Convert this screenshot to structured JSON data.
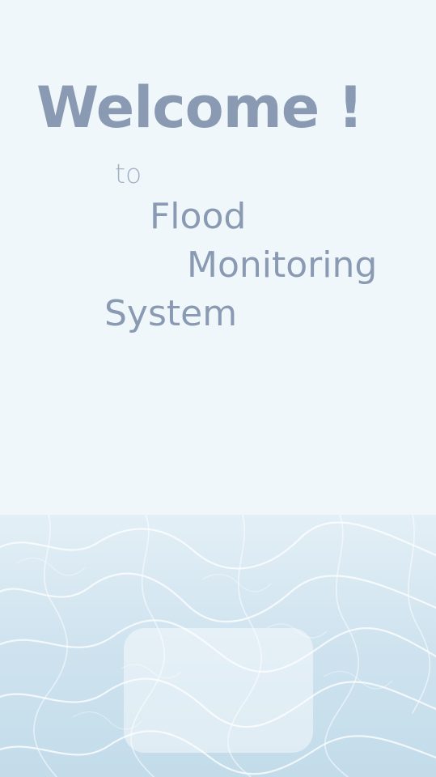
{
  "welcome": {
    "heading": "Welcome !",
    "line_to": "to",
    "line_flood": "Flood",
    "line_monitoring": "Monitoring",
    "line_system": "System"
  },
  "colors": {
    "background": "#eff7fb",
    "heading_text": "#8a9ab2",
    "water": "#cfe3ef"
  }
}
